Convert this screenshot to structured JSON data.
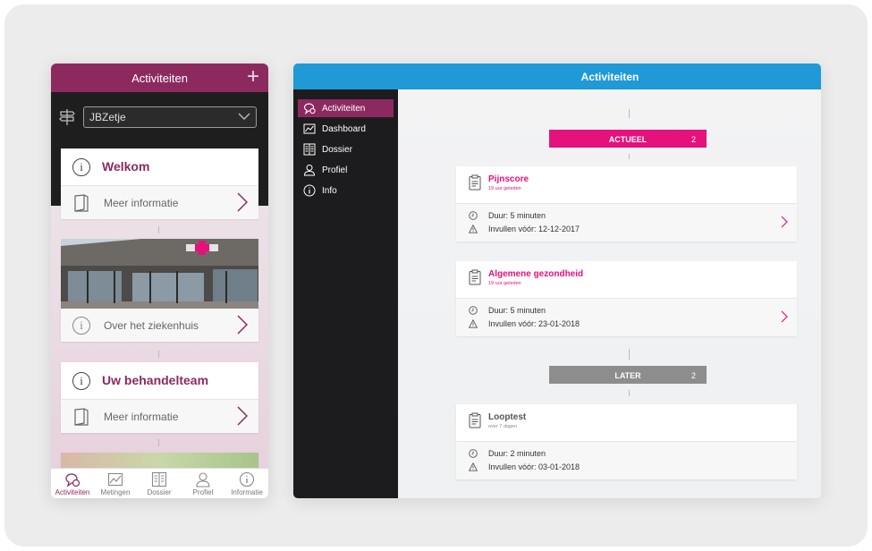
{
  "phone": {
    "header_title": "Activiteiten",
    "plus_icon": "plus-icon",
    "select_value": "JBZetje",
    "cards": {
      "welkom": {
        "title": "Welkom",
        "info": "Meer informatie"
      },
      "hospital": {
        "info": "Over het ziekenhuis"
      },
      "team": {
        "title": "Uw behandelteam",
        "info": "Meer informatie"
      }
    },
    "tabs": [
      {
        "label": "Activiteiten",
        "icon": "activities-icon"
      },
      {
        "label": "Metingen",
        "icon": "chart-icon"
      },
      {
        "label": "Dossier",
        "icon": "dossier-icon"
      },
      {
        "label": "Profiel",
        "icon": "profile-icon"
      },
      {
        "label": "Informatie",
        "icon": "info-icon"
      }
    ]
  },
  "tablet": {
    "header_title": "Activiteiten",
    "sidebar": [
      {
        "label": "Activiteiten",
        "icon": "activities-icon"
      },
      {
        "label": "Dashboard",
        "icon": "chart-icon"
      },
      {
        "label": "Dossier",
        "icon": "dossier-icon"
      },
      {
        "label": "Profiel",
        "icon": "profile-icon"
      },
      {
        "label": "Info",
        "icon": "info-icon"
      }
    ],
    "groups": {
      "actueel": {
        "label": "ACTUEEL",
        "count": "2"
      },
      "later": {
        "label": "LATER",
        "count": "2"
      }
    },
    "activities": [
      {
        "name": "Pijnscore",
        "when": "19 uur geleden",
        "duration": "Duur: 5 minuten",
        "deadline": "Invullen vóór: 12-12-2017"
      },
      {
        "name": "Algemene gezondheid",
        "when": "19 uur geleden",
        "duration": "Duur: 5 minuten",
        "deadline": "Invullen vóór: 23-01-2018"
      },
      {
        "name": "Looptest",
        "when": "over 7 dagen",
        "duration": "Duur: 2 minuten",
        "deadline": "Invullen vóór: 03-01-2018"
      }
    ]
  },
  "colors": {
    "brand_purple": "#8c2a60",
    "accent_pink": "#e5117c",
    "header_blue": "#1f9ad6",
    "later_gray": "#8d8d8d"
  }
}
